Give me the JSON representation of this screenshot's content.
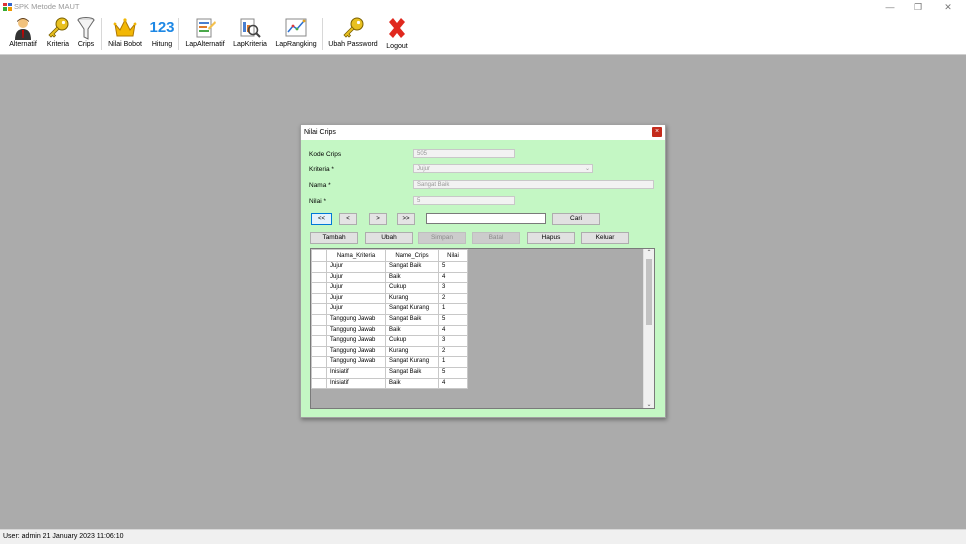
{
  "window": {
    "title": "SPK Metode MAUT",
    "minimize": "—",
    "restore": "❐",
    "close": "✕"
  },
  "toolbar": {
    "items": [
      {
        "label": "Alternatif",
        "icon": "user-icon"
      },
      {
        "label": "Kriteria",
        "icon": "key-icon"
      },
      {
        "label": "Crips",
        "icon": "funnel-icon"
      },
      {
        "label": "Nilai Bobot",
        "icon": "crown-icon"
      },
      {
        "label": "Hitung",
        "icon": "numbers-icon",
        "icon_text": "123"
      },
      {
        "label": "LapAlternatif",
        "icon": "report-icon"
      },
      {
        "label": "LapKriteria",
        "icon": "search-report-icon"
      },
      {
        "label": "LapRangking",
        "icon": "chart-icon"
      },
      {
        "label": "Ubah Password",
        "icon": "key-icon"
      },
      {
        "label": "Logout",
        "icon": "close-icon"
      }
    ]
  },
  "dialog": {
    "title": "Nilai Crips",
    "close": "×",
    "fields": {
      "kode_label": "Kode Crips",
      "kode_value": "505",
      "kriteria_label": "Kriteria *",
      "kriteria_value": "Jujur",
      "nama_label": "Nama *",
      "nama_value": "Sangat Baik",
      "nilai_label": "Nilai *",
      "nilai_value": "5"
    },
    "nav": {
      "first": "<<",
      "prev": "<",
      "next": ">",
      "last": ">>"
    },
    "search": {
      "value": "",
      "button": "Cari"
    },
    "buttons": {
      "tambah": "Tambah",
      "ubah": "Ubah",
      "simpan": "Simpan",
      "batal": "Batal",
      "hapus": "Hapus",
      "keluar": "Keluar"
    },
    "table": {
      "headers": [
        "Nama_Kriteria",
        "Name_Crips",
        "Nilai"
      ],
      "rows": [
        [
          "Jujur",
          "Sangat Baik",
          "5"
        ],
        [
          "Jujur",
          "Baik",
          "4"
        ],
        [
          "Jujur",
          "Cukup",
          "3"
        ],
        [
          "Jujur",
          "Kurang",
          "2"
        ],
        [
          "Jujur",
          "Sangat Kurang",
          "1"
        ],
        [
          "Tanggung Jawab",
          "Sangat Baik",
          "5"
        ],
        [
          "Tanggung Jawab",
          "Baik",
          "4"
        ],
        [
          "Tanggung Jawab",
          "Cukup",
          "3"
        ],
        [
          "Tanggung Jawab",
          "Kurang",
          "2"
        ],
        [
          "Tanggung Jawab",
          "Sangat Kurang",
          "1"
        ],
        [
          "Inisiatif",
          "Sangat Baik",
          "5"
        ],
        [
          "Inisiatif",
          "Baik",
          "4"
        ]
      ]
    }
  },
  "status": {
    "text": "User: admin  21 January 2023 11:06:10"
  }
}
